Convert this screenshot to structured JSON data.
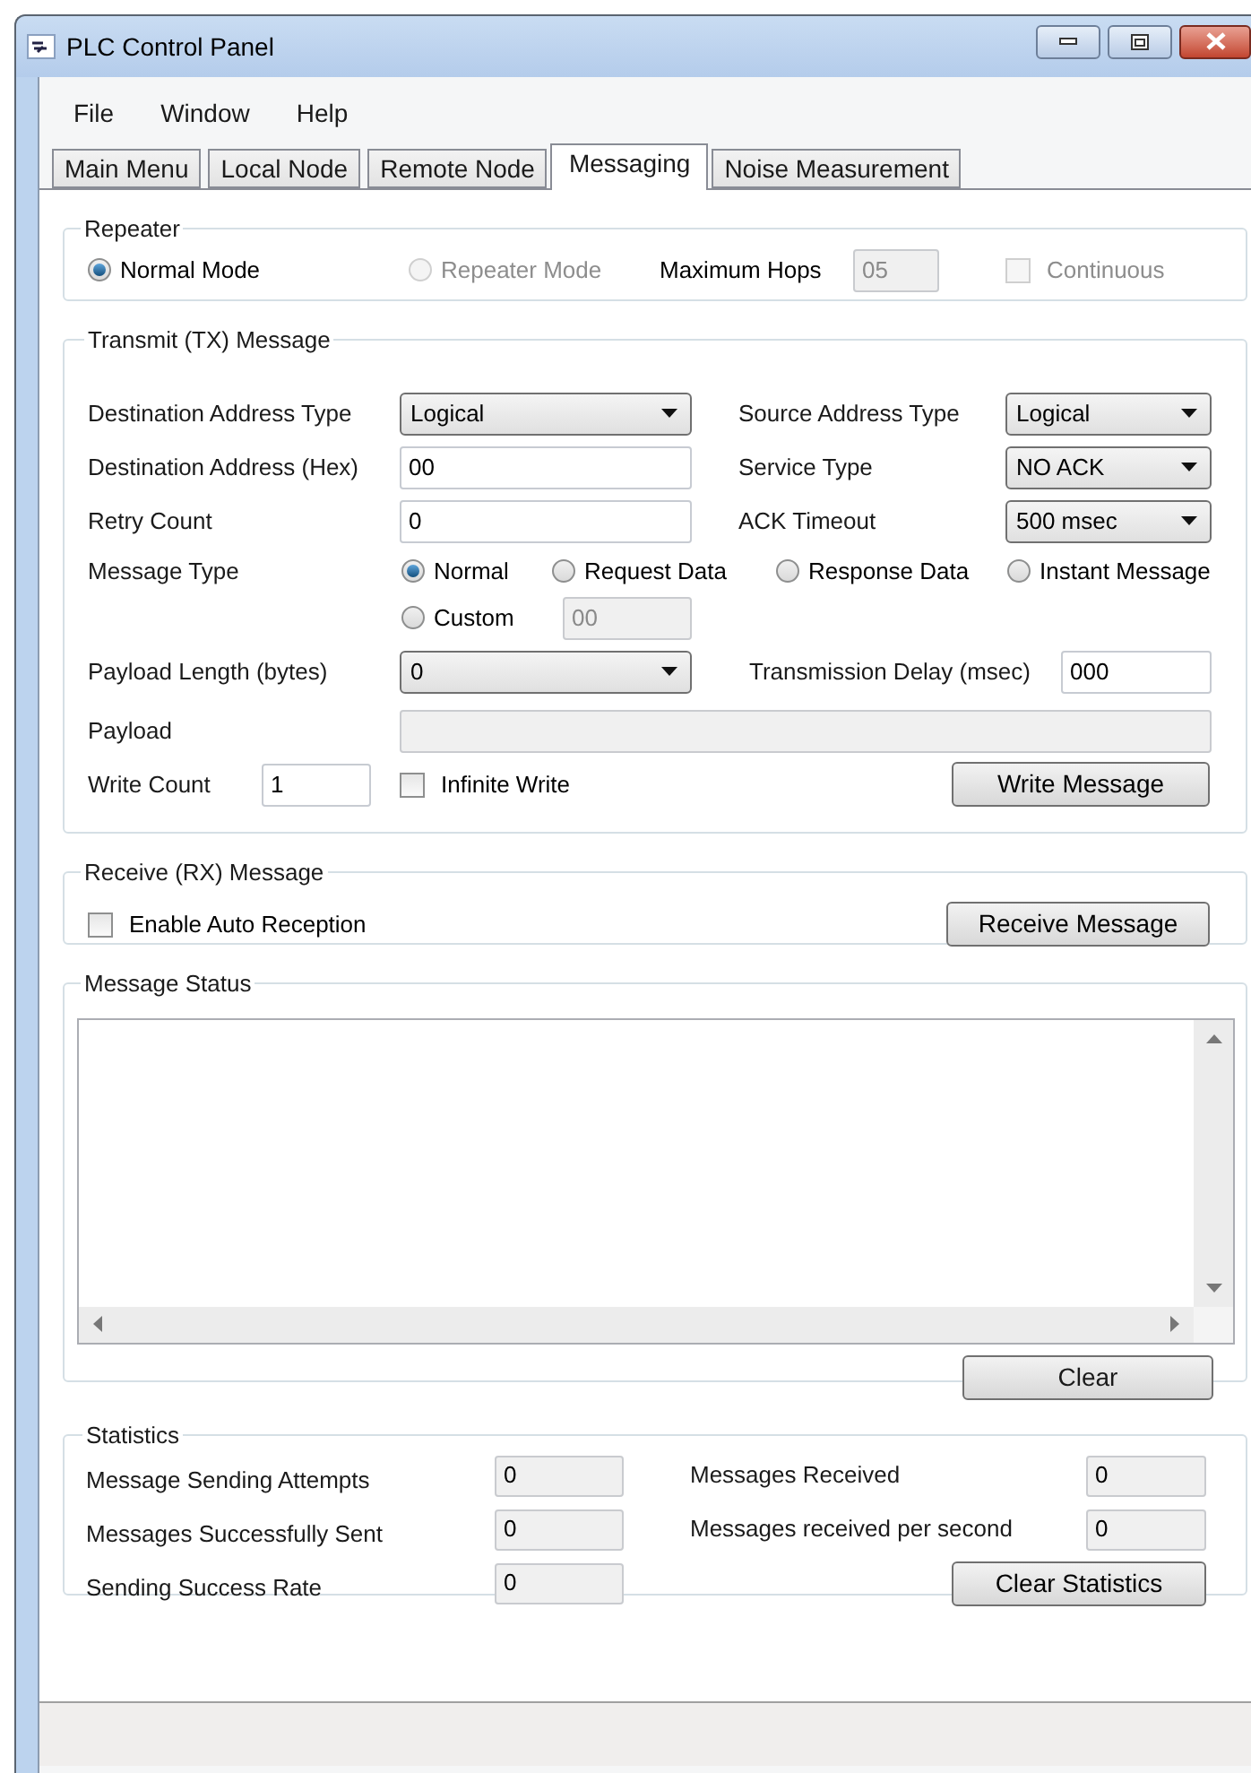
{
  "window": {
    "title": "PLC Control Panel"
  },
  "menu": [
    "File",
    "Window",
    "Help"
  ],
  "tabs": [
    {
      "label": "Main Menu",
      "selected": false
    },
    {
      "label": "Local Node",
      "selected": false
    },
    {
      "label": "Remote Node",
      "selected": false
    },
    {
      "label": "Messaging",
      "selected": true
    },
    {
      "label": "Noise Measurement",
      "selected": false
    }
  ],
  "repeater": {
    "title": "Repeater",
    "modes": [
      {
        "label": "Normal Mode",
        "selected": true,
        "disabled": false
      },
      {
        "label": "Repeater Mode",
        "selected": false,
        "disabled": true
      }
    ],
    "max_hops": {
      "label": "Maximum Hops",
      "value": "05",
      "disabled": true
    },
    "continuous": {
      "label": "Continuous",
      "checked": false,
      "disabled": true
    }
  },
  "transmit": {
    "title": "Transmit (TX) Message",
    "destination_address_type": {
      "label": "Destination Address Type",
      "value": "Logical"
    },
    "source_address_type": {
      "label": "Source Address Type",
      "value": "Logical"
    },
    "destination_address": {
      "label": "Destination Address (Hex)",
      "value": "00"
    },
    "service_type": {
      "label": "Service Type",
      "value": "NO ACK"
    },
    "retry_count": {
      "label": "Retry Count",
      "value": "0"
    },
    "ack_timeout": {
      "label": "ACK Timeout",
      "value": "500 msec"
    },
    "message_type": {
      "label": "Message Type",
      "options": [
        {
          "label": "Normal",
          "selected": true
        },
        {
          "label": "Request Data",
          "selected": false
        },
        {
          "label": "Response Data",
          "selected": false
        },
        {
          "label": "Instant Message",
          "selected": false
        },
        {
          "label": "Custom",
          "selected": false
        }
      ],
      "custom_value": {
        "value": "00",
        "disabled": true
      }
    },
    "payload_length": {
      "label": "Payload Length (bytes)",
      "value": "0"
    },
    "transmission_delay": {
      "label": "Transmission Delay (msec)",
      "value": "000"
    },
    "payload": {
      "label": "Payload",
      "disabled": true
    },
    "write_count": {
      "label": "Write Count",
      "value": "1"
    },
    "infinite_write": {
      "label": "Infinite Write",
      "checked": false
    },
    "write_button": "Write Message"
  },
  "receive": {
    "title": "Receive (RX) Message",
    "auto_reception": {
      "label": "Enable Auto Reception",
      "checked": false
    },
    "receive_button": "Receive Message"
  },
  "message_status": {
    "title": "Message Status",
    "clear_button": "Clear"
  },
  "statistics": {
    "title": "Statistics",
    "left": [
      {
        "label": "Message Sending Attempts",
        "value": "0"
      },
      {
        "label": "Messages Successfully Sent",
        "value": "0"
      },
      {
        "label": "Sending Success Rate",
        "value": "0"
      }
    ],
    "right": [
      {
        "label": "Messages Received",
        "value": "0"
      },
      {
        "label": "Messages received per second",
        "value": "0"
      }
    ],
    "clear_button": "Clear Statistics"
  }
}
